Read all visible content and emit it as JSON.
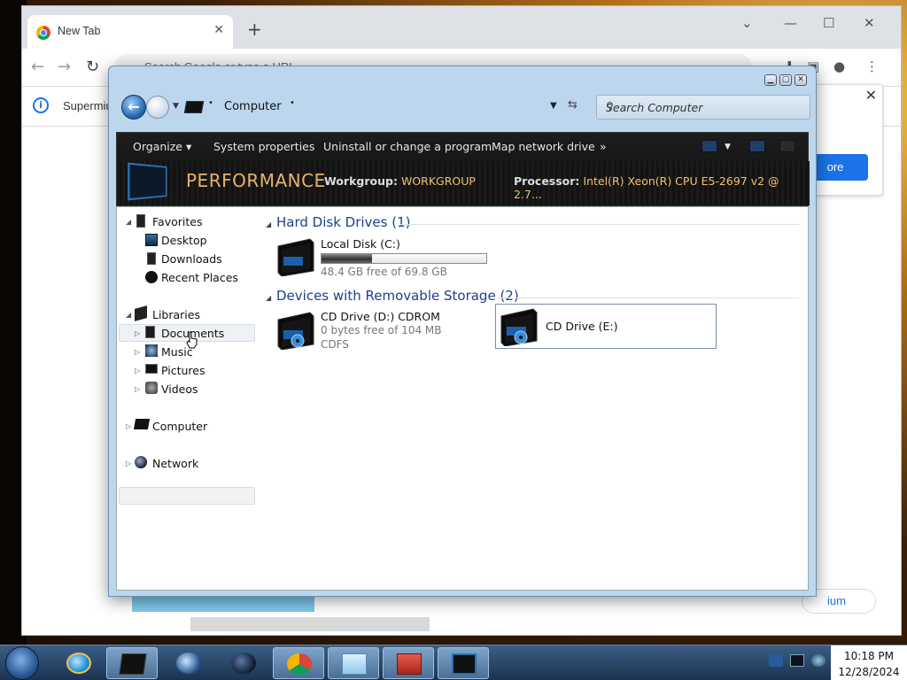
{
  "browser": {
    "tab_title": "New Tab",
    "omnibox_placeholder": "Search Google or type a URL",
    "infobar_text": "Supermiu",
    "popup_button": "ore",
    "pill_text": "ium"
  },
  "explorer": {
    "breadcrumb": "Computer",
    "search_placeholder": "Search Computer",
    "commands": [
      "Organize",
      "System properties",
      "Uninstall or change a program",
      "Map network drive",
      "»"
    ],
    "perf_title": "PERFORMANCE",
    "workgroup_label": "Workgroup:",
    "workgroup_value": "WORKGROUP",
    "processor_label": "Processor:",
    "processor_value": "Intel(R) Xeon(R) CPU E5-2697 v2 @ 2.7...",
    "nav": {
      "favorites": "Favorites",
      "desktop": "Desktop",
      "downloads": "Downloads",
      "recent": "Recent Places",
      "libraries": "Libraries",
      "documents": "Documents",
      "music": "Music",
      "pictures": "Pictures",
      "videos": "Videos",
      "computer": "Computer",
      "network": "Network"
    },
    "groups": {
      "hdd": "Hard Disk Drives (1)",
      "removable": "Devices with Removable Storage (2)"
    },
    "drives": {
      "c_name": "Local Disk (C:)",
      "c_free": "48.4 GB free of 69.8 GB",
      "c_used_fraction": 0.307,
      "d_name": "CD Drive (D:) CDROM",
      "d_free": "0 bytes free of 104 MB",
      "d_fs": "CDFS",
      "e_name": "CD Drive (E:)"
    }
  },
  "taskbar": {
    "time": "10:18 PM",
    "date": "12/28/2024"
  }
}
